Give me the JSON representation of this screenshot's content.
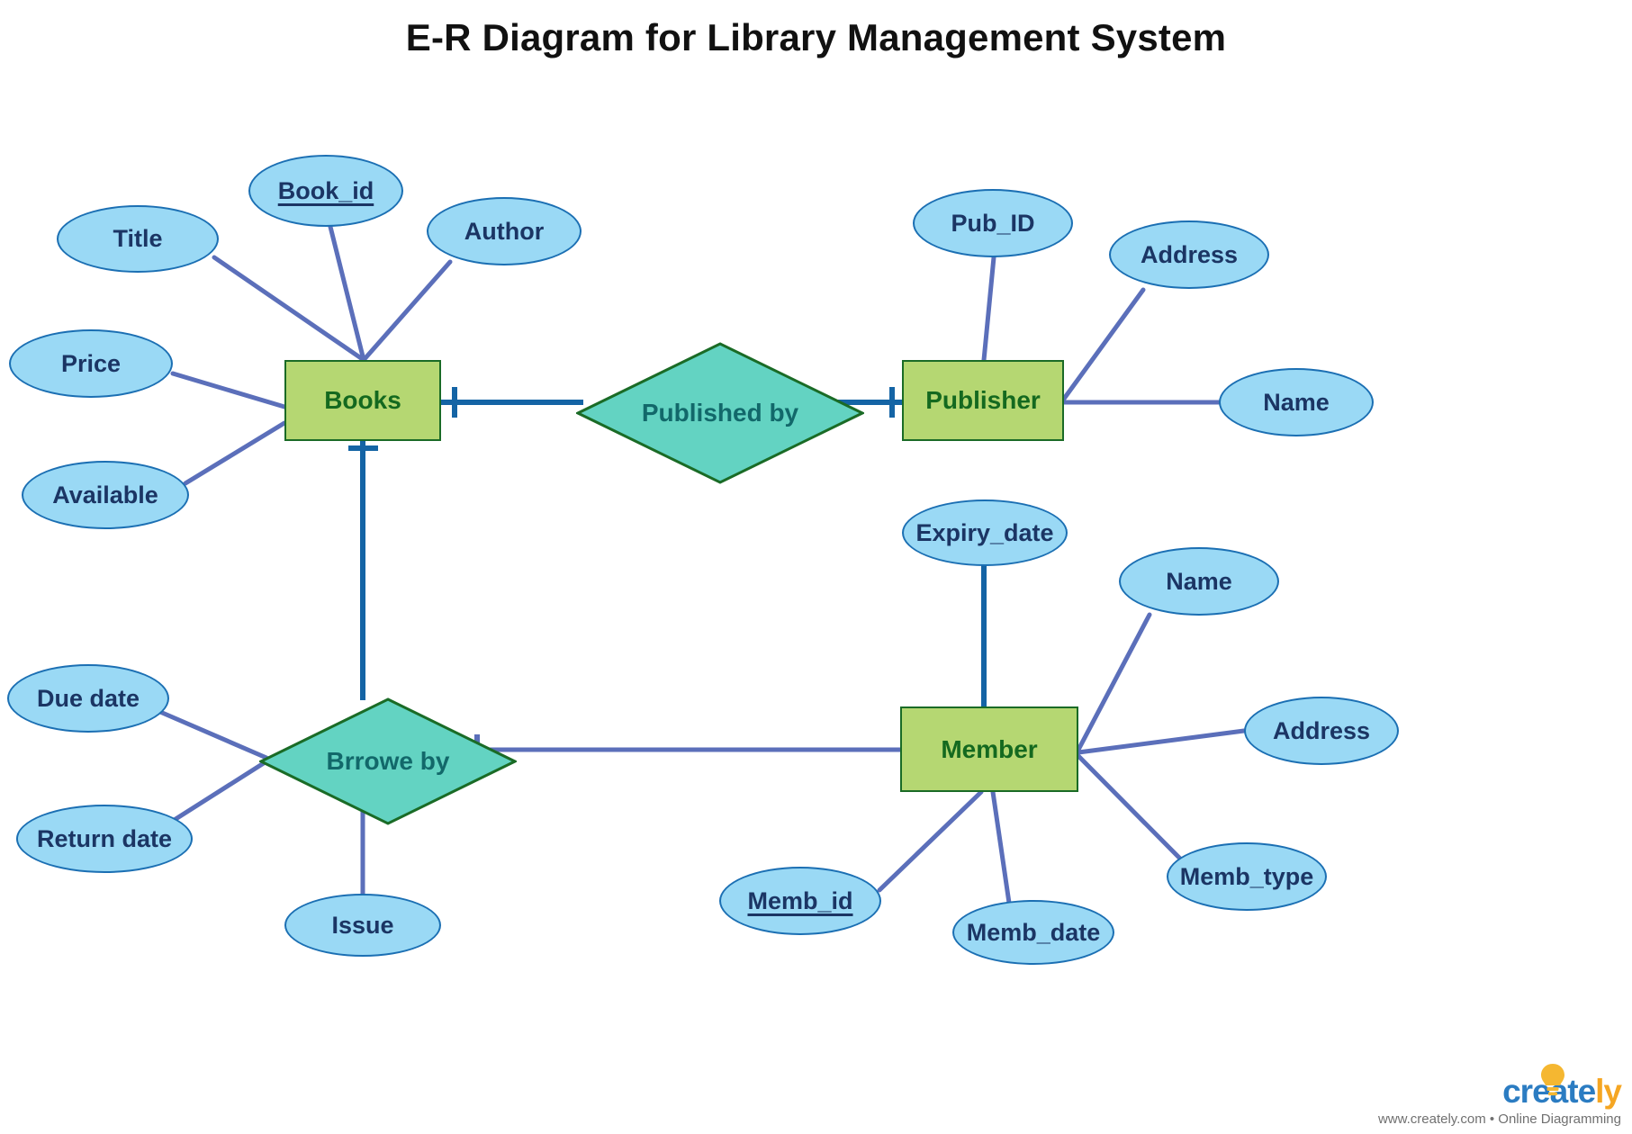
{
  "title": "E-R Diagram for Library Management System",
  "colors": {
    "attribute_fill": "#9ad9f5",
    "attribute_stroke": "#1b6fb3",
    "attribute_text": "#1b3564",
    "entity_fill": "#b5d772",
    "entity_stroke": "#1a6b26",
    "entity_text": "#14691f",
    "relationship_fill": "#63d3c2",
    "relationship_stroke": "#1a6b26",
    "relationship_text": "#12686a",
    "connector_violet": "#5b6fba",
    "connector_blue": "#1464a5",
    "background": "#ffffff",
    "title_text": "#111111"
  },
  "entities": [
    {
      "id": "books",
      "label": "Books"
    },
    {
      "id": "publisher",
      "label": "Publisher"
    },
    {
      "id": "member",
      "label": "Member"
    }
  ],
  "relationships": [
    {
      "id": "published_by",
      "label": "Published by",
      "between": [
        "Books",
        "Publisher"
      ]
    },
    {
      "id": "brrowe_by",
      "label": "Brrowe by",
      "between": [
        "Books",
        "Member"
      ]
    }
  ],
  "attributes": [
    {
      "id": "title",
      "label": "Title",
      "owner": "Books",
      "key": false
    },
    {
      "id": "book_id",
      "label": "Book_id",
      "owner": "Books",
      "key": true
    },
    {
      "id": "author",
      "label": "Author",
      "owner": "Books",
      "key": false
    },
    {
      "id": "price",
      "label": "Price",
      "owner": "Books",
      "key": false
    },
    {
      "id": "available",
      "label": "Available",
      "owner": "Books",
      "key": false
    },
    {
      "id": "pub_id",
      "label": "Pub_ID",
      "owner": "Publisher",
      "key": false
    },
    {
      "id": "pub_address",
      "label": "Address",
      "owner": "Publisher",
      "key": false
    },
    {
      "id": "pub_name",
      "label": "Name",
      "owner": "Publisher",
      "key": false
    },
    {
      "id": "expiry_date",
      "label": "Expiry_date",
      "owner": "Member",
      "key": false
    },
    {
      "id": "mem_name",
      "label": "Name",
      "owner": "Member",
      "key": false
    },
    {
      "id": "mem_address",
      "label": "Address",
      "owner": "Member",
      "key": false
    },
    {
      "id": "memb_type",
      "label": "Memb_type",
      "owner": "Member",
      "key": false
    },
    {
      "id": "memb_id",
      "label": "Memb_id",
      "owner": "Member",
      "key": true
    },
    {
      "id": "memb_date",
      "label": "Memb_date",
      "owner": "Member",
      "key": false
    },
    {
      "id": "due_date",
      "label": "Due date",
      "owner": "Brrowe by",
      "key": false
    },
    {
      "id": "return_date",
      "label": "Return date",
      "owner": "Brrowe by",
      "key": false
    },
    {
      "id": "issue",
      "label": "Issue",
      "owner": "Brrowe by",
      "key": false
    }
  ],
  "watermark": {
    "word_first": "create",
    "word_second": "ly",
    "tagline": "www.creately.com • Online Diagramming"
  }
}
